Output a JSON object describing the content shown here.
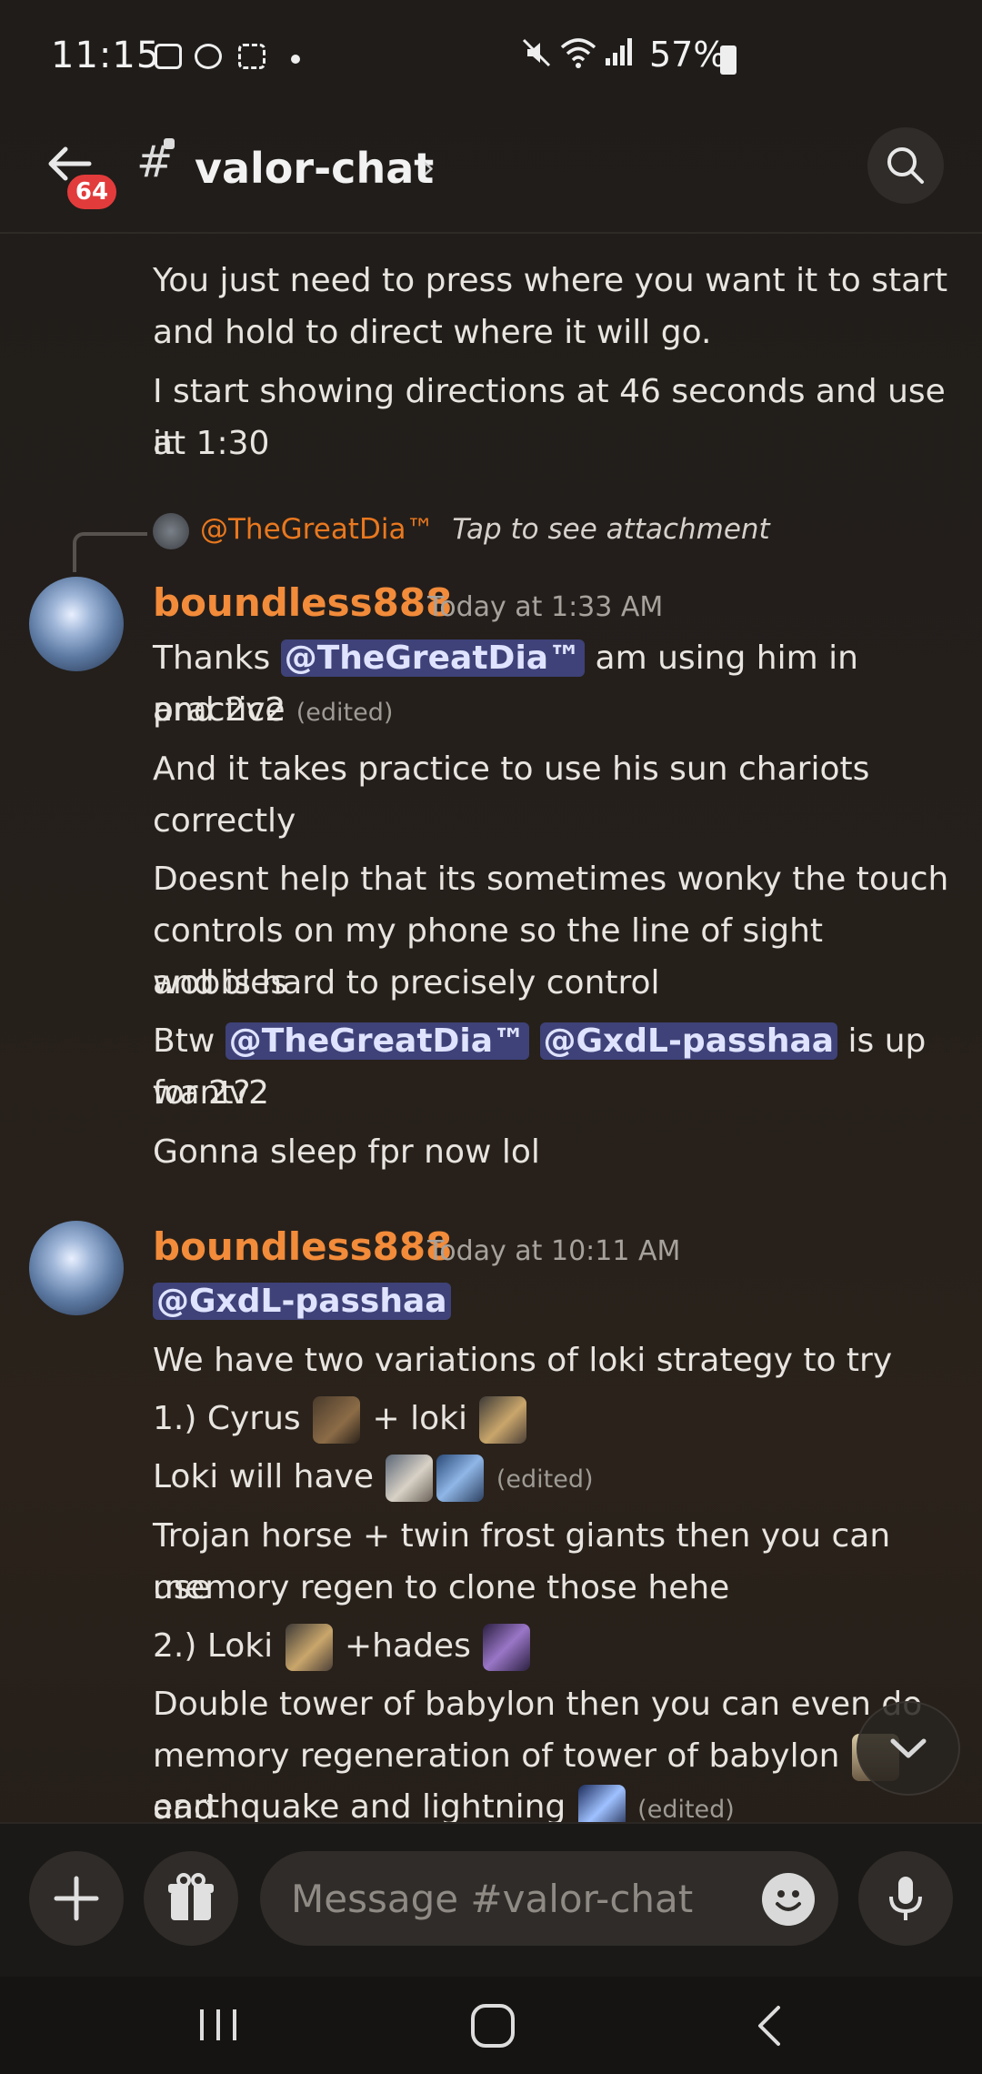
{
  "status_bar": {
    "time": "11:15",
    "battery": "57%"
  },
  "header": {
    "unread_badge": "64",
    "channel_name": "valor-chat"
  },
  "messages": {
    "cont_lines": [
      "You just need to press where you want it to start",
      "and hold to direct where it will go.",
      "I start showing directions at 46 seconds and use it",
      "at 1:30"
    ],
    "reply": {
      "name": "@TheGreatDia™",
      "text": "Tap to see attachment"
    },
    "m1": {
      "username": "boundless888",
      "timestamp": "Today at 1:33 AM",
      "l1_a": "Thanks ",
      "l1_mention": "@TheGreatDia™",
      "l1_b": "  am using him in practice",
      "l2": "and 2v2",
      "edited": "(edited)",
      "l3": "And it takes practice to use his sun chariots",
      "l4": "correctly",
      "l5": "Doesnt help that its sometimes wonky the touch",
      "l6": "controls on my phone so the line of sight wobbles",
      "l7": "and is hard to precisely control",
      "l8_a": "Btw ",
      "l8_m1": "@TheGreatDia™",
      "l8_m2": "@GxdL-passhaa",
      "l8_b": " is up for 2v2",
      "l9": "want?",
      "l10": "Gonna sleep fpr now lol"
    },
    "m2": {
      "username": "boundless888",
      "timestamp": "Today at 10:11 AM",
      "mention": "@GxdL-passhaa",
      "l1": "We have two variations of loki strategy to try",
      "l2_a": "1.) Cyrus ",
      "l2_b": " + loki ",
      "l3": "Loki will have ",
      "edited": "(edited)",
      "l4": "Trojan horse + twin frost giants then you can use",
      "l5": "memory regen to clone those hehe",
      "l6_a": "2.) Loki ",
      "l6_b": " +hades ",
      "l7": "Double tower of babylon then you can even do",
      "l8_a": "memory regeneration of tower of babylon ",
      "l8_b": " and",
      "l9": "earthquake and lightning "
    }
  },
  "composer": {
    "placeholder": "Message #valor-chat"
  },
  "icons": {
    "accent": "#f28b3a",
    "mention_bg": "#3e4278",
    "badge": "#e23b3b"
  }
}
